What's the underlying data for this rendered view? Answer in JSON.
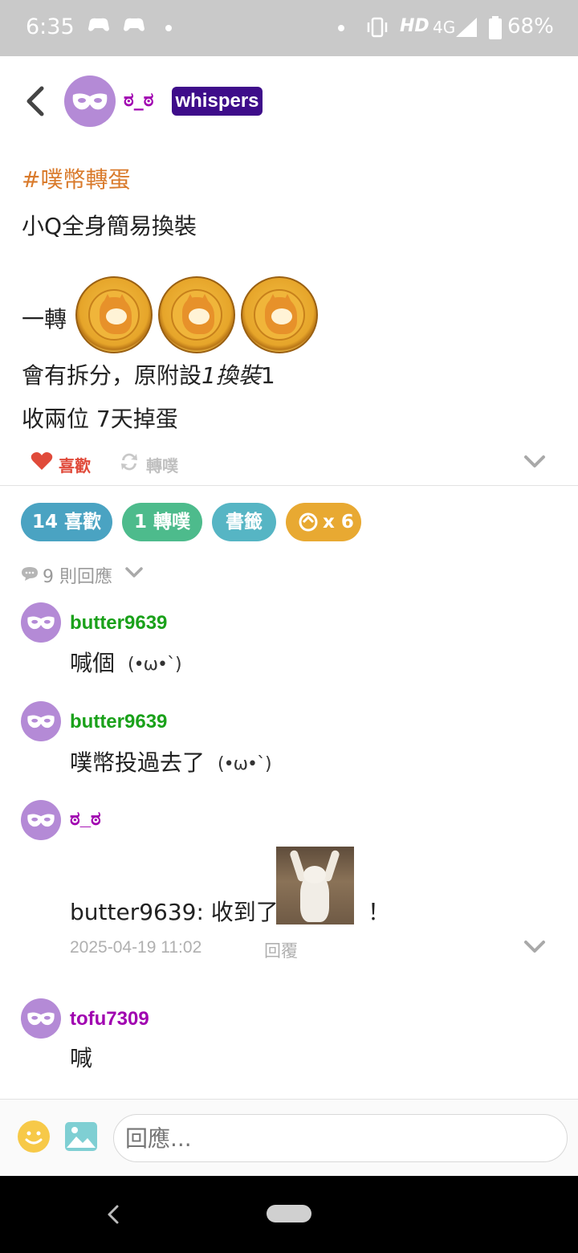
{
  "status_bar": {
    "time": "6:35",
    "network_label": "HD",
    "signal_label": "4G",
    "battery": "68%"
  },
  "header": {
    "author": "ಠ_ಠ",
    "badge": "whispers"
  },
  "post": {
    "hashtag": "#噗幣轉蛋",
    "line1": "小Q全身簡易換裝",
    "line2_prefix": "一轉",
    "coin_count": 3,
    "line3_a": "會有拆分，原附設",
    "line3_b": "1換裝",
    "line3_c": "1",
    "line4": "收兩位 7天掉蛋",
    "like_label": "喜歡",
    "replurk_label": "轉噗"
  },
  "stats": {
    "likes": "14 喜歡",
    "replurks": "1 轉噗",
    "bookmark": "書籤",
    "coins": "x 6"
  },
  "responses": {
    "count_label": "9 則回應",
    "items": [
      {
        "name": "butter9639",
        "text": "喊個",
        "kaomoji": "(•ω•ˋ)",
        "color": "#1aa11a"
      },
      {
        "name": "butter9639",
        "text": "噗幣投過去了",
        "kaomoji": "(•ω•ˋ)",
        "color": "#1aa11a"
      },
      {
        "name": "ಠ_ಠ",
        "text": "butter9639: 收到了",
        "suffix": "！",
        "color": "#a000b0",
        "time": "2025-04-19 11:02",
        "reply_label": "回覆"
      },
      {
        "name": "tofu7309",
        "text": "喊",
        "color": "#a000b0"
      }
    ]
  },
  "composer": {
    "placeholder": "回應..."
  },
  "colors": {
    "accent_purple": "#3e0d8a",
    "hashtag_orange": "#d97a2b",
    "like_red": "#e04a3a",
    "pill_likes": "#4aa3c2",
    "pill_replurks": "#4dbb8c",
    "pill_bookmark": "#56b5c4",
    "pill_coins": "#e8a932"
  }
}
